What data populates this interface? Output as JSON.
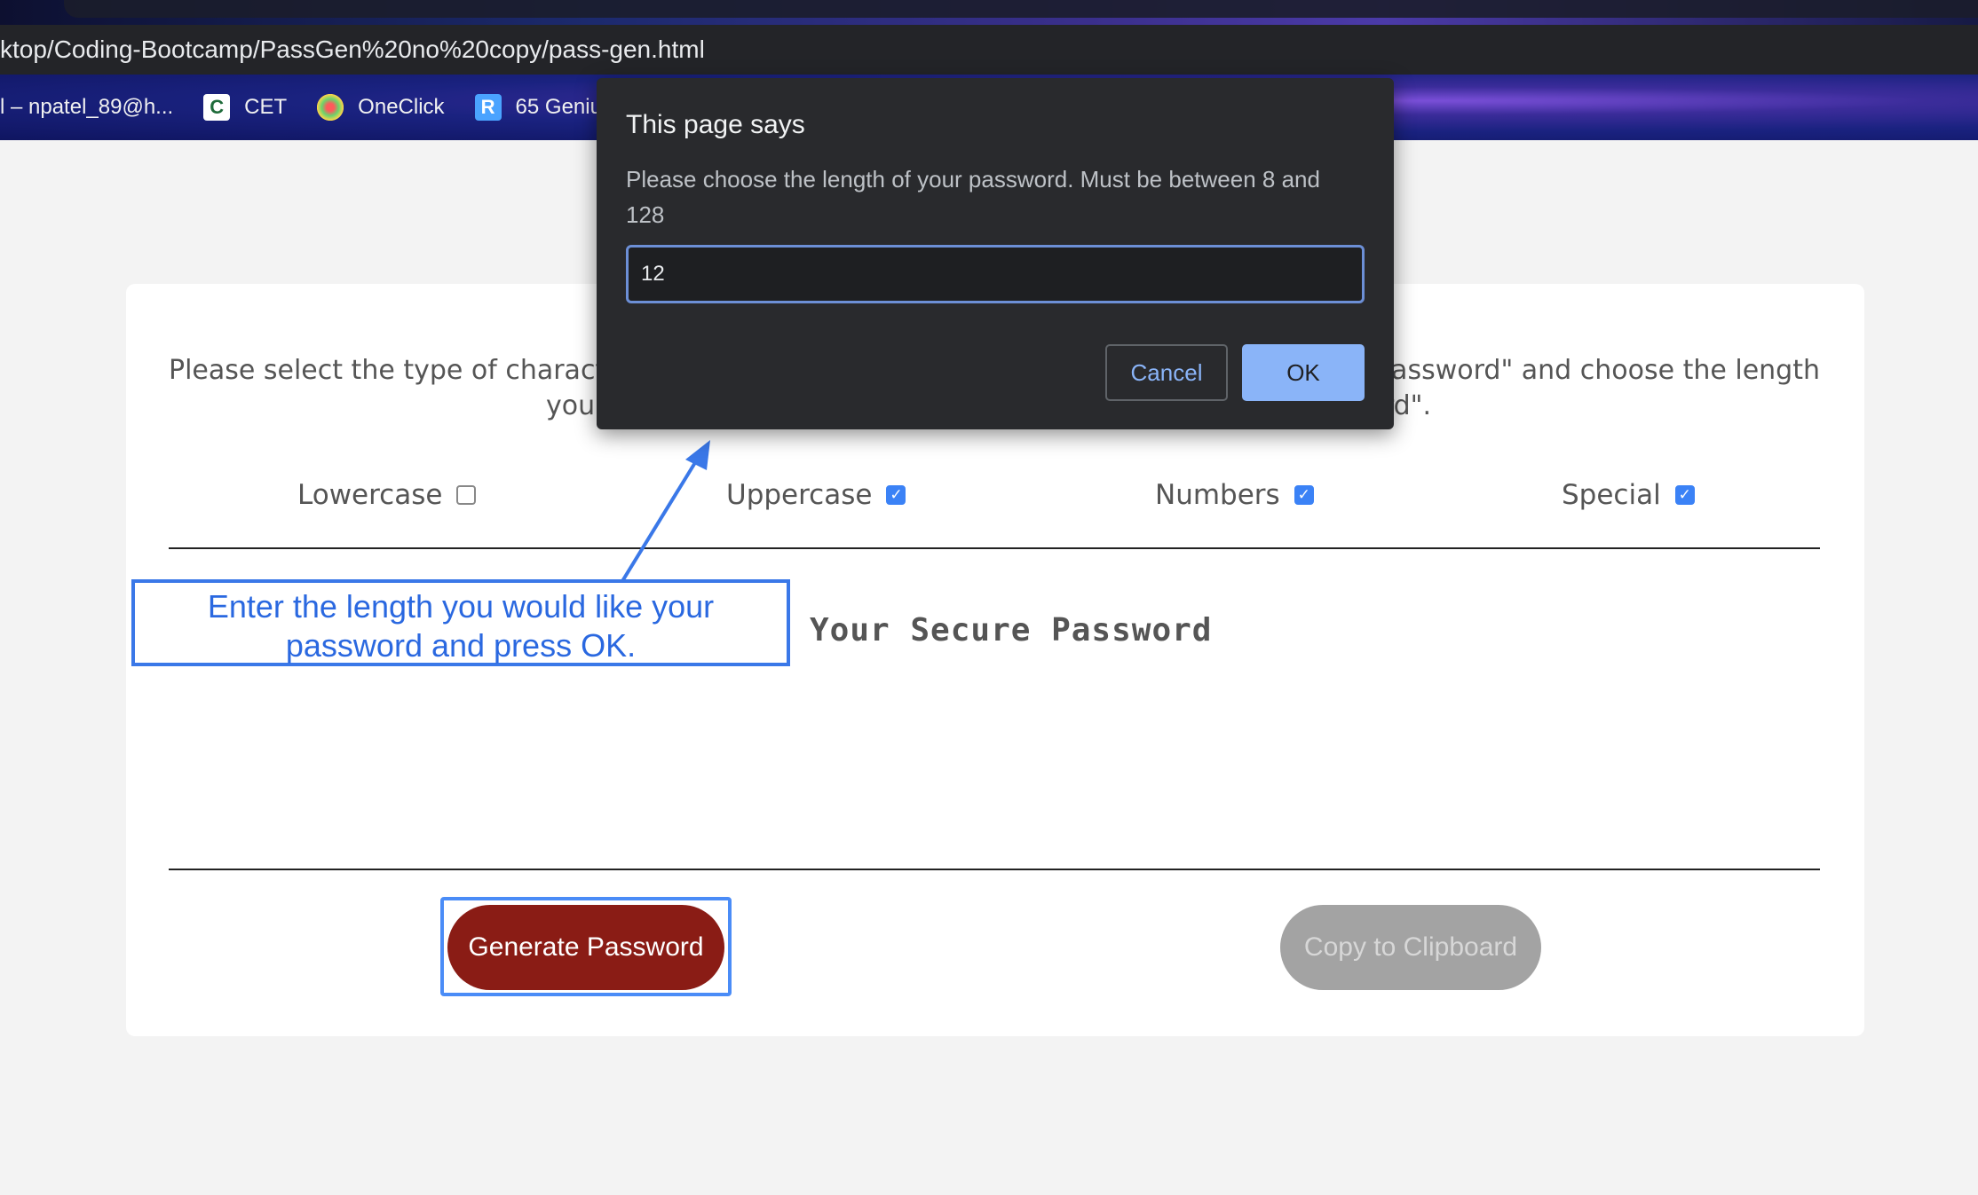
{
  "browser": {
    "url": "ktop/Coding-Bootcamp/PassGen%20no%20copy/pass-gen.html",
    "bookmarks": [
      {
        "label": "l – npatel_89@h...",
        "icon": "mail-icon"
      },
      {
        "label": "CET",
        "icon": "cet-icon"
      },
      {
        "label": "OneClick",
        "icon": "oneclick-icon"
      },
      {
        "label": "65 Geniu",
        "icon": "genius-icon"
      }
    ]
  },
  "page": {
    "instructions_left": "Please select the type of charact",
    "instructions_right": "password\" and choose the length",
    "instructions_line2_left": "you",
    "instructions_line2_right": "rd\".",
    "criteria": [
      {
        "label": "Lowercase",
        "checked": false
      },
      {
        "label": "Uppercase",
        "checked": true
      },
      {
        "label": "Numbers",
        "checked": true
      },
      {
        "label": "Special",
        "checked": true
      }
    ],
    "password_title": "Your Secure Password",
    "generate_label": "Generate Password",
    "copy_label": "Copy to Clipboard"
  },
  "annotation": {
    "text_line1": "Enter the length you would like your",
    "text_line2": "password and press OK."
  },
  "dialog": {
    "title": "This page says",
    "message": "Please choose the length of your password. Must be between 8 and 128",
    "input_value": "12",
    "cancel_label": "Cancel",
    "ok_label": "OK"
  },
  "colors": {
    "generate_button": "#8a1c15",
    "copy_button_disabled": "#a3a3a3",
    "checkbox_checked": "#3b82f6",
    "annotation": "#3a78e8",
    "dialog_bg": "#292a2d"
  }
}
